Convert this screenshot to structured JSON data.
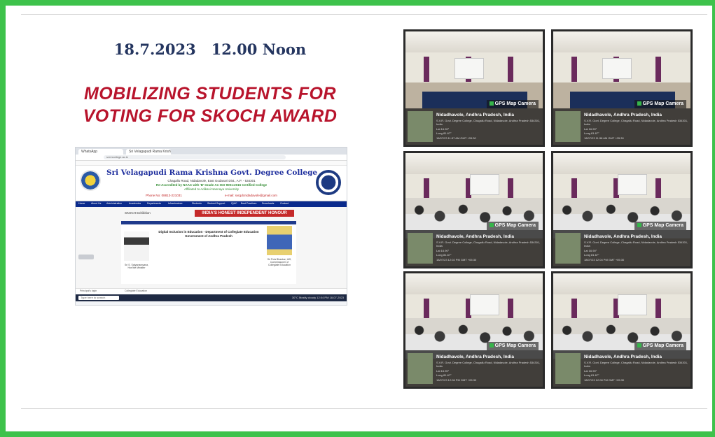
{
  "event": {
    "date_time": "18.7.2023   12.00 Noon",
    "headline_line1": "MOBILIZING STUDENTS FOR",
    "headline_line2": "VOTING FOR SKOCH AWARD"
  },
  "website": {
    "tab1": "WhatsApp",
    "tab2": "Sri Velagapudi Rama Krishna...",
    "url": "svrmcollege.ac.in",
    "college_name": "Sri Velagapudi Rama Krishna Govt. Degree College",
    "address": "Chagallu Road, Nidadavole, East Godavari Dist., A.P. - 534301",
    "accreditation": "Re-Accredited by NAAC with 'B' Grade    An ISO 9001:2015 Certified College",
    "affiliation": "Affiliated to Adikavi Nannaya University",
    "phone": "Phone No: 08813-221031",
    "email": "e-mail: svrgdcnidadavole@gmail.com",
    "nav_items": [
      "Home",
      "About Us",
      "Administration",
      "Academics",
      "Departments",
      "Infrastructure",
      "Students",
      "Student Support",
      "IQAC",
      "Best Practices",
      "Downloads",
      "Contact"
    ],
    "exhibition_label": "SKOCH Exhibition",
    "marquee": "INDIA'S HONEST INDEPENDENT HONOUR",
    "panel_title": "Digital Inclusion in Education - Department of Collegiate Education Government of Andhra Pradesh",
    "person_left_caption": "Sri S. Satyanarayana, Hon'ble Minister",
    "person_right_caption": "Sri Pola Bhaskar, IAS, Commissioner of Collegiate Education",
    "bottom_tab1": "Principal's login",
    "bottom_tab2": "Collegiate Education",
    "search_placeholder": "Type here to search",
    "tray": "30°C Mostly cloudy   12:04 PM  18-07-2023"
  },
  "photos": [
    {
      "gps": "GPS Map Camera",
      "title": "Nidadhavole, Andhra Pradesh, India",
      "address": "S.V.R. Govt. Degree College, Chagallu Road, Nidadavole, Andhra Pradesh 534301, India",
      "lat": "Lat 16.90°",
      "long": "Long 81.67°",
      "time": "18/07/23 11:57 AM GMT +05:30"
    },
    {
      "gps": "GPS Map Camera",
      "title": "Nidadhavole, Andhra Pradesh, India",
      "address": "S.V.R. Govt. Degree College, Chagallu Road, Nidadavole, Andhra Pradesh 534301, India",
      "lat": "Lat 16.90°",
      "long": "Long 81.67°",
      "time": "18/07/23 11:58 AM GMT +05:30"
    },
    {
      "gps": "GPS Map Camera",
      "title": "Nidadhavole, Andhra Pradesh, India",
      "address": "S.V.R. Govt. Degree College, Chagallu Road, Nidadavole, Andhra Pradesh 534301, India",
      "lat": "Lat 16.90°",
      "long": "Long 81.67°",
      "time": "18/07/23 12:02 PM GMT +05:30"
    },
    {
      "gps": "GPS Map Camera",
      "title": "Nidadhavole, Andhra Pradesh, India",
      "address": "S.V.R. Govt. Degree College, Chagallu Road, Nidadavole, Andhra Pradesh 534301, India",
      "lat": "Lat 16.90°",
      "long": "Long 81.67°",
      "time": "18/07/23 12:04 PM GMT +05:30"
    },
    {
      "gps": "GPS Map Camera",
      "title": "Nidadhavole, Andhra Pradesh, India",
      "address": "S.V.R. Govt. Degree College, Chagallu Road, Nidadavole, Andhra Pradesh 534301, India",
      "lat": "Lat 16.90°",
      "long": "Long 81.67°",
      "time": "18/07/23 12:06 PM GMT +05:30"
    },
    {
      "gps": "GPS Map Camera",
      "title": "Nidadhavole, Andhra Pradesh, India",
      "address": "S.V.R. Govt. Degree College, Chagallu Road, Nidadavole, Andhra Pradesh 534301, India",
      "lat": "Lat 16.90°",
      "long": "Long 81.67°",
      "time": "18/07/23 12:08 PM GMT +05:30"
    }
  ],
  "colors": {
    "frame": "#3ec24b",
    "date_text": "#24355f",
    "headline_text": "#b8142c",
    "college_blue": "#1f2f9e"
  }
}
